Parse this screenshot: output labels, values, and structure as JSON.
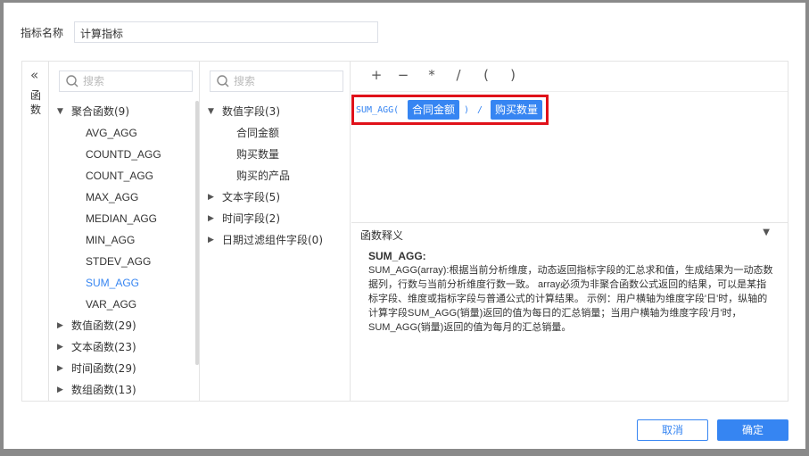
{
  "indicator": {
    "label": "指标名称",
    "value": "计算指标"
  },
  "sidebar": {
    "collapse_icon": "double-chevron-left",
    "label": "函\n数"
  },
  "functions": {
    "search_placeholder": "搜索",
    "groups": [
      {
        "label": "聚合函数(9)",
        "expanded": true,
        "items": [
          "AVG_AGG",
          "COUNTD_AGG",
          "COUNT_AGG",
          "MAX_AGG",
          "MEDIAN_AGG",
          "MIN_AGG",
          "STDEV_AGG",
          "SUM_AGG",
          "VAR_AGG"
        ]
      },
      {
        "label": "数值函数(29)",
        "expanded": false
      },
      {
        "label": "文本函数(23)",
        "expanded": false
      },
      {
        "label": "时间函数(29)",
        "expanded": false
      },
      {
        "label": "数组函数(13)",
        "expanded": false
      }
    ],
    "selected": "SUM_AGG"
  },
  "fields": {
    "search_placeholder": "搜索",
    "groups": [
      {
        "label": "数值字段(3)",
        "expanded": true,
        "items": [
          "合同金额",
          "购买数量",
          "购买的产品"
        ]
      },
      {
        "label": "文本字段(5)",
        "expanded": false
      },
      {
        "label": "时间字段(2)",
        "expanded": false
      },
      {
        "label": "日期过滤组件字段(0)",
        "expanded": false
      }
    ]
  },
  "operators": [
    "+",
    "−",
    "*",
    "/",
    "(",
    ")"
  ],
  "formula": {
    "prefix": "SUM_AGG(",
    "field1": "合同金额",
    "close": ")",
    "divide": "/",
    "field2": "购买数量"
  },
  "description": {
    "title": "函数释义",
    "func_name": "SUM_AGG:",
    "text": "SUM_AGG(array):根据当前分析维度，动态返回指标字段的汇总求和值，生成结果为一动态数据列，行数与当前分析维度行数一致。 array必须为非聚合函数公式返回的结果，可以是某指标字段、维度或指标字段与普通公式的计算结果。 示例：用户横轴为维度字段'日'时，纵轴的计算字段SUM_AGG(销量)返回的值为每日的汇总销量；当用户横轴为维度字段'月'时，SUM_AGG(销量)返回的值为每月的汇总销量。"
  },
  "buttons": {
    "cancel": "取消",
    "ok": "确定"
  },
  "colors": {
    "accent": "#3685f2",
    "highlight_border": "#e0111a"
  }
}
